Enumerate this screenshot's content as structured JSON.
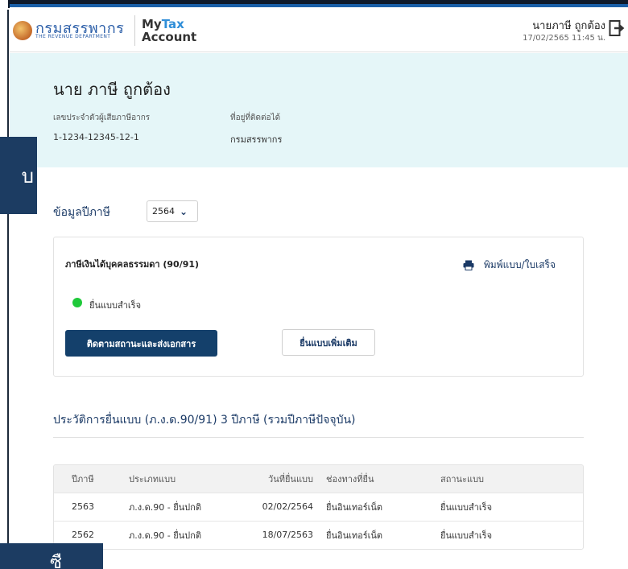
{
  "header": {
    "logo_text": "กรมสรรพากร",
    "logo_subtext": "THE REVENUE DEPARTMENT",
    "app_name_part1": "My",
    "app_name_accent": "Tax",
    "app_name_part2": "Account",
    "user_name": "นายภาษี ถูกต้อง",
    "datetime": "17/02/2565  11:45 น.",
    "logout_icon": "logout-icon"
  },
  "profile": {
    "name": "นาย ภาษี ถูกต้อง",
    "tax_id_label": "เลขประจำตัวผู้เสียภาษีอากร",
    "tax_id_value": "1-1234-12345-12-1",
    "address_label": "ที่อยู่ที่ติดต่อได้",
    "address_value": "กรมสรรพากร"
  },
  "overlays": {
    "mid_text": "บ",
    "bottom_text": "ซื"
  },
  "tax_year": {
    "label": "ข้อมูลปีภาษี",
    "selected": "2564",
    "icon": "chevron-down-icon"
  },
  "tax_card": {
    "title": "ภาษีเงินได้บุคคลธรรมดา (90/91)",
    "print_label": "พิมพ์แบบ/ใบเสร็จ",
    "print_icon": "printer-icon",
    "status_text": "ยื่นแบบสำเร็จ",
    "status_color": "#1fc93a",
    "track_button": "ติดตามสถานะและส่งเอกสาร",
    "additional_button": "ยื่นแบบเพิ่มเติม"
  },
  "history": {
    "title": "ประวัติการยื่นแบบ (ภ.ง.ด.90/91) 3 ปีภาษี (รวมปีภาษีปัจจุบัน)",
    "columns": [
      "ปีภาษี",
      "ประเภทแบบ",
      "วันที่ยื่นแบบ",
      "ช่องทางที่ยื่น",
      "สถานะแบบ"
    ],
    "rows": [
      [
        "2563",
        "ภ.ง.ด.90 - ยื่นปกติ",
        "02/02/2564",
        "ยื่นอินเทอร์เน็ต",
        "ยื่นแบบสำเร็จ"
      ],
      [
        "2562",
        "ภ.ง.ด.90 - ยื่นปกติ",
        "18/07/2563",
        "ยื่นอินเทอร์เน็ต",
        "ยื่นแบบสำเร็จ"
      ]
    ]
  },
  "colors": {
    "brand_navy": "#14406b",
    "header_accent": "#1a5fa8",
    "profile_band": "#e5f6f8",
    "tax_accent": "#2f8ed8"
  }
}
